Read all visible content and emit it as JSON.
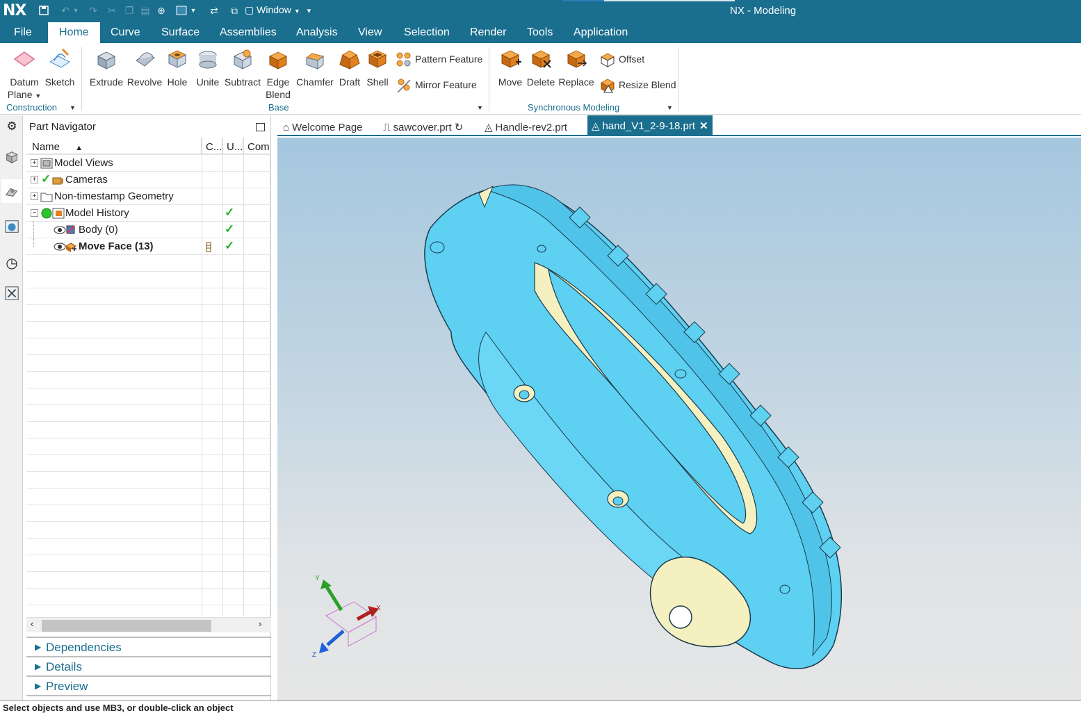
{
  "app": {
    "logo": "NX",
    "title": "NX - Modeling",
    "window_menu": "Window"
  },
  "menu": [
    "File",
    "Home",
    "Curve",
    "Surface",
    "Assemblies",
    "Analysis",
    "View",
    "Selection",
    "Render",
    "Tools",
    "Application"
  ],
  "ribbon": {
    "datum_plane": "Datum Plane",
    "datum_plane_line1": "Datum",
    "datum_plane_line2": "Plane",
    "sketch": "Sketch",
    "extrude": "Extrude",
    "revolve": "Revolve",
    "hole": "Hole",
    "unite": "Unite",
    "subtract": "Subtract",
    "edge_blend_line1": "Edge",
    "edge_blend_line2": "Blend",
    "chamfer": "Chamfer",
    "draft": "Draft",
    "shell": "Shell",
    "pattern_feature": "Pattern Feature",
    "mirror_feature": "Mirror Feature",
    "move": "Move",
    "delete": "Delete",
    "replace": "Replace",
    "offset": "Offset",
    "resize_blend": "Resize Blend",
    "group_construction": "Construction",
    "group_base": "Base",
    "group_sync": "Synchronous Modeling"
  },
  "navigator": {
    "title": "Part Navigator",
    "columns": [
      "Name",
      "C...",
      "U...",
      "Com"
    ],
    "rows": [
      {
        "label": "Model Views"
      },
      {
        "label": "Cameras"
      },
      {
        "label": "Non-timestamp Geometry"
      },
      {
        "label": "Model History"
      },
      {
        "label": "Body (0)"
      },
      {
        "label": "Move Face (13)"
      }
    ],
    "panels": [
      "Dependencies",
      "Details",
      "Preview"
    ]
  },
  "tabs": [
    {
      "label": "Welcome Page"
    },
    {
      "label": "sawcover.prt"
    },
    {
      "label": "Handle-rev2.prt"
    },
    {
      "label": "hand_V1_2-9-18.prt"
    }
  ],
  "triad": {
    "x": "X",
    "y": "Y",
    "z": "Z"
  },
  "status": "Select objects and use MB3, or double-click an object",
  "colors": {
    "brand": "#1a6e8e",
    "model": "#5ed0f2",
    "model_face_accent": "#f5f0c0"
  }
}
